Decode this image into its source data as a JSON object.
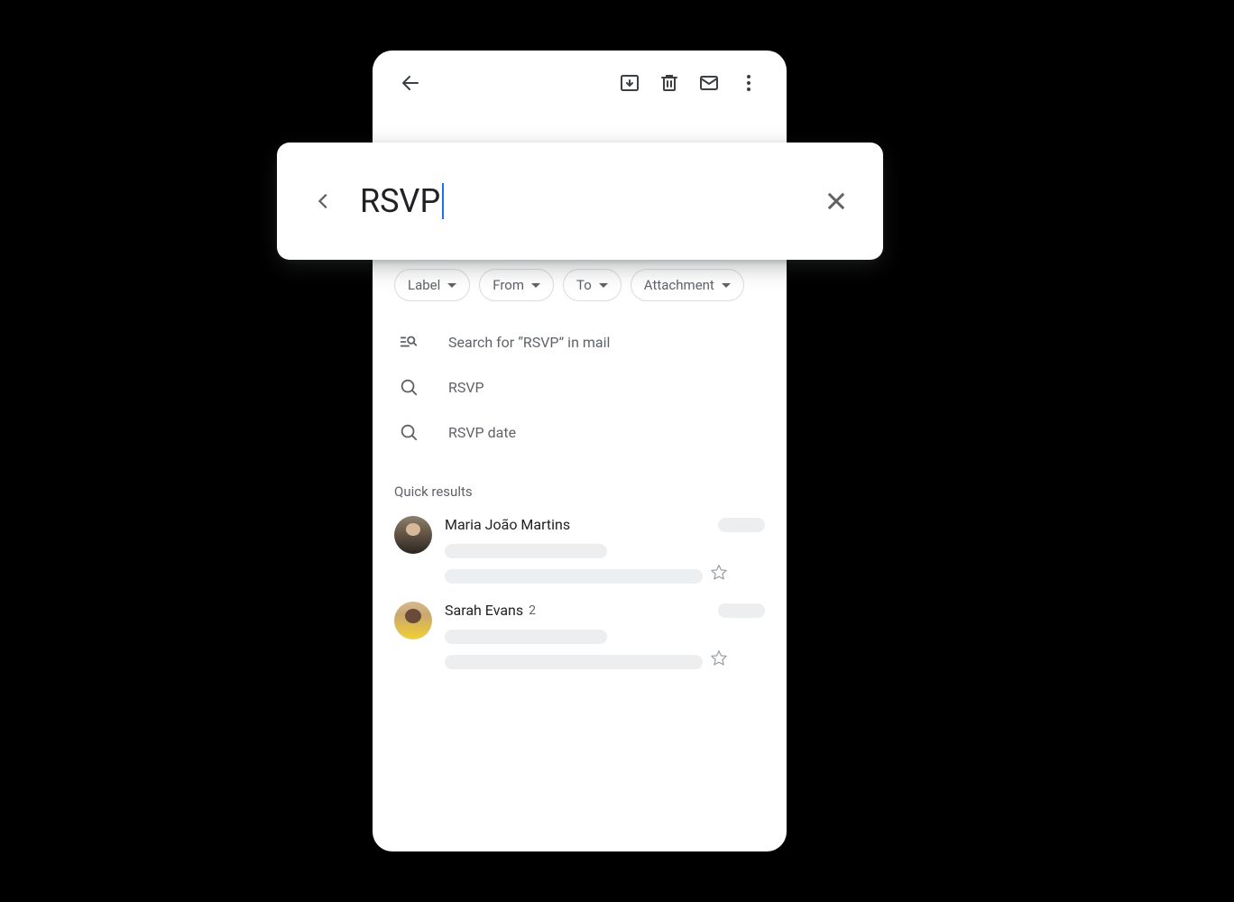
{
  "search": {
    "query": "RSVP",
    "search_for_text": "Search for “RSVP” in mail"
  },
  "chips": [
    {
      "label": "Label"
    },
    {
      "label": "From"
    },
    {
      "label": "To"
    },
    {
      "label": "Attachment"
    }
  ],
  "suggestions": [
    {
      "text": "RSVP"
    },
    {
      "text": "RSVP date"
    }
  ],
  "section_header": "Quick results",
  "results": [
    {
      "name": "Maria João Martins",
      "count": ""
    },
    {
      "name": "Sarah Evans",
      "count": "2"
    }
  ]
}
